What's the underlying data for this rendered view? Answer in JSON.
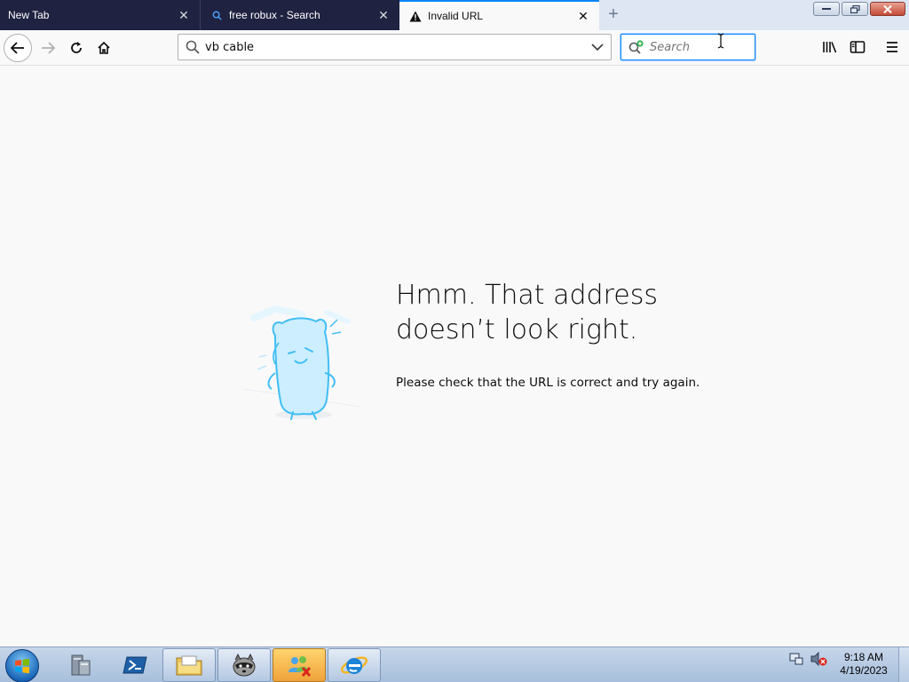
{
  "tabs": [
    {
      "label": "New Tab"
    },
    {
      "label": "free robux - Search"
    },
    {
      "label": "Invalid URL"
    }
  ],
  "navbar": {
    "url_value": "vb cable",
    "search_placeholder": "Search"
  },
  "error": {
    "title_line1": "Hmm. That address",
    "title_line2": "doesn’t look right.",
    "description": "Please check that the URL is correct and try again."
  },
  "taskbar": {
    "time": "9:18 AM",
    "date": "4/19/2023"
  },
  "icons": {
    "tab2": "search-icon",
    "tab3": "warning-icon",
    "start": "windows-logo-icon",
    "taskbar_items": [
      "server-manager-icon",
      "powershell-icon",
      "file-explorer-icon",
      "raccoon-app-icon",
      "users-app-icon",
      "internet-explorer-icon"
    ]
  },
  "colors": {
    "accent": "#0a84ff",
    "dark_tab": "#1f2240",
    "page_bg": "#f9f9fa"
  }
}
